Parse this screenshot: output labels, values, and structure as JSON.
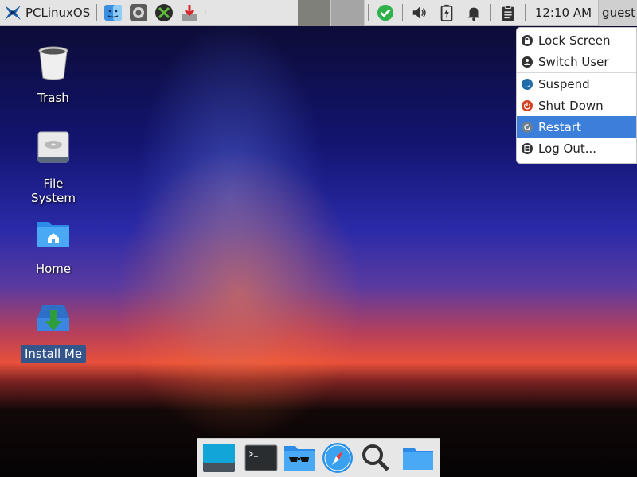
{
  "panel": {
    "menu_label": "PCLinuxOS",
    "launchers": [
      "finder-icon",
      "settings-icon",
      "tools-icon",
      "download-icon"
    ],
    "clock": "12:10 AM",
    "user": "guest"
  },
  "desktop": {
    "icons": [
      {
        "label": "Trash"
      },
      {
        "label": "File System"
      },
      {
        "label": "Home"
      },
      {
        "label": "Install Me"
      }
    ]
  },
  "user_menu": {
    "items": [
      {
        "label": "Lock Screen"
      },
      {
        "label": "Switch User"
      },
      {
        "label": "Suspend"
      },
      {
        "label": "Shut Down"
      },
      {
        "label": "Restart"
      },
      {
        "label": "Log Out..."
      }
    ],
    "highlighted": "Restart"
  },
  "colors": {
    "panel_bg": "#e4e4e4",
    "menu_highlight": "#3b7fda",
    "selected_label_bg": "#33558a"
  }
}
